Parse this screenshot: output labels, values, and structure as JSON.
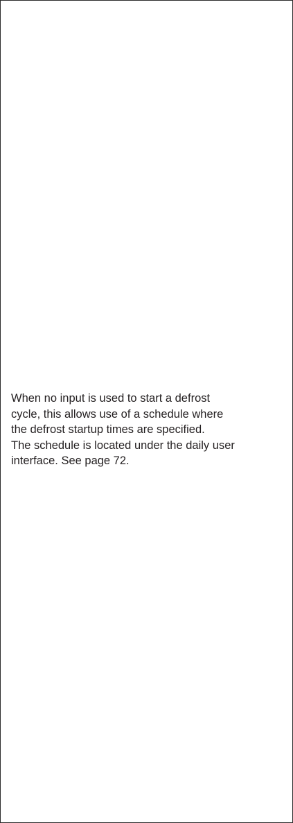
{
  "content": {
    "lines": [
      "When no input is used to start a defrost",
      "cycle, this allows use of a schedule where",
      "the defrost startup times are specified.",
      "The schedule is located under the daily user",
      "interface. See page 72."
    ]
  }
}
